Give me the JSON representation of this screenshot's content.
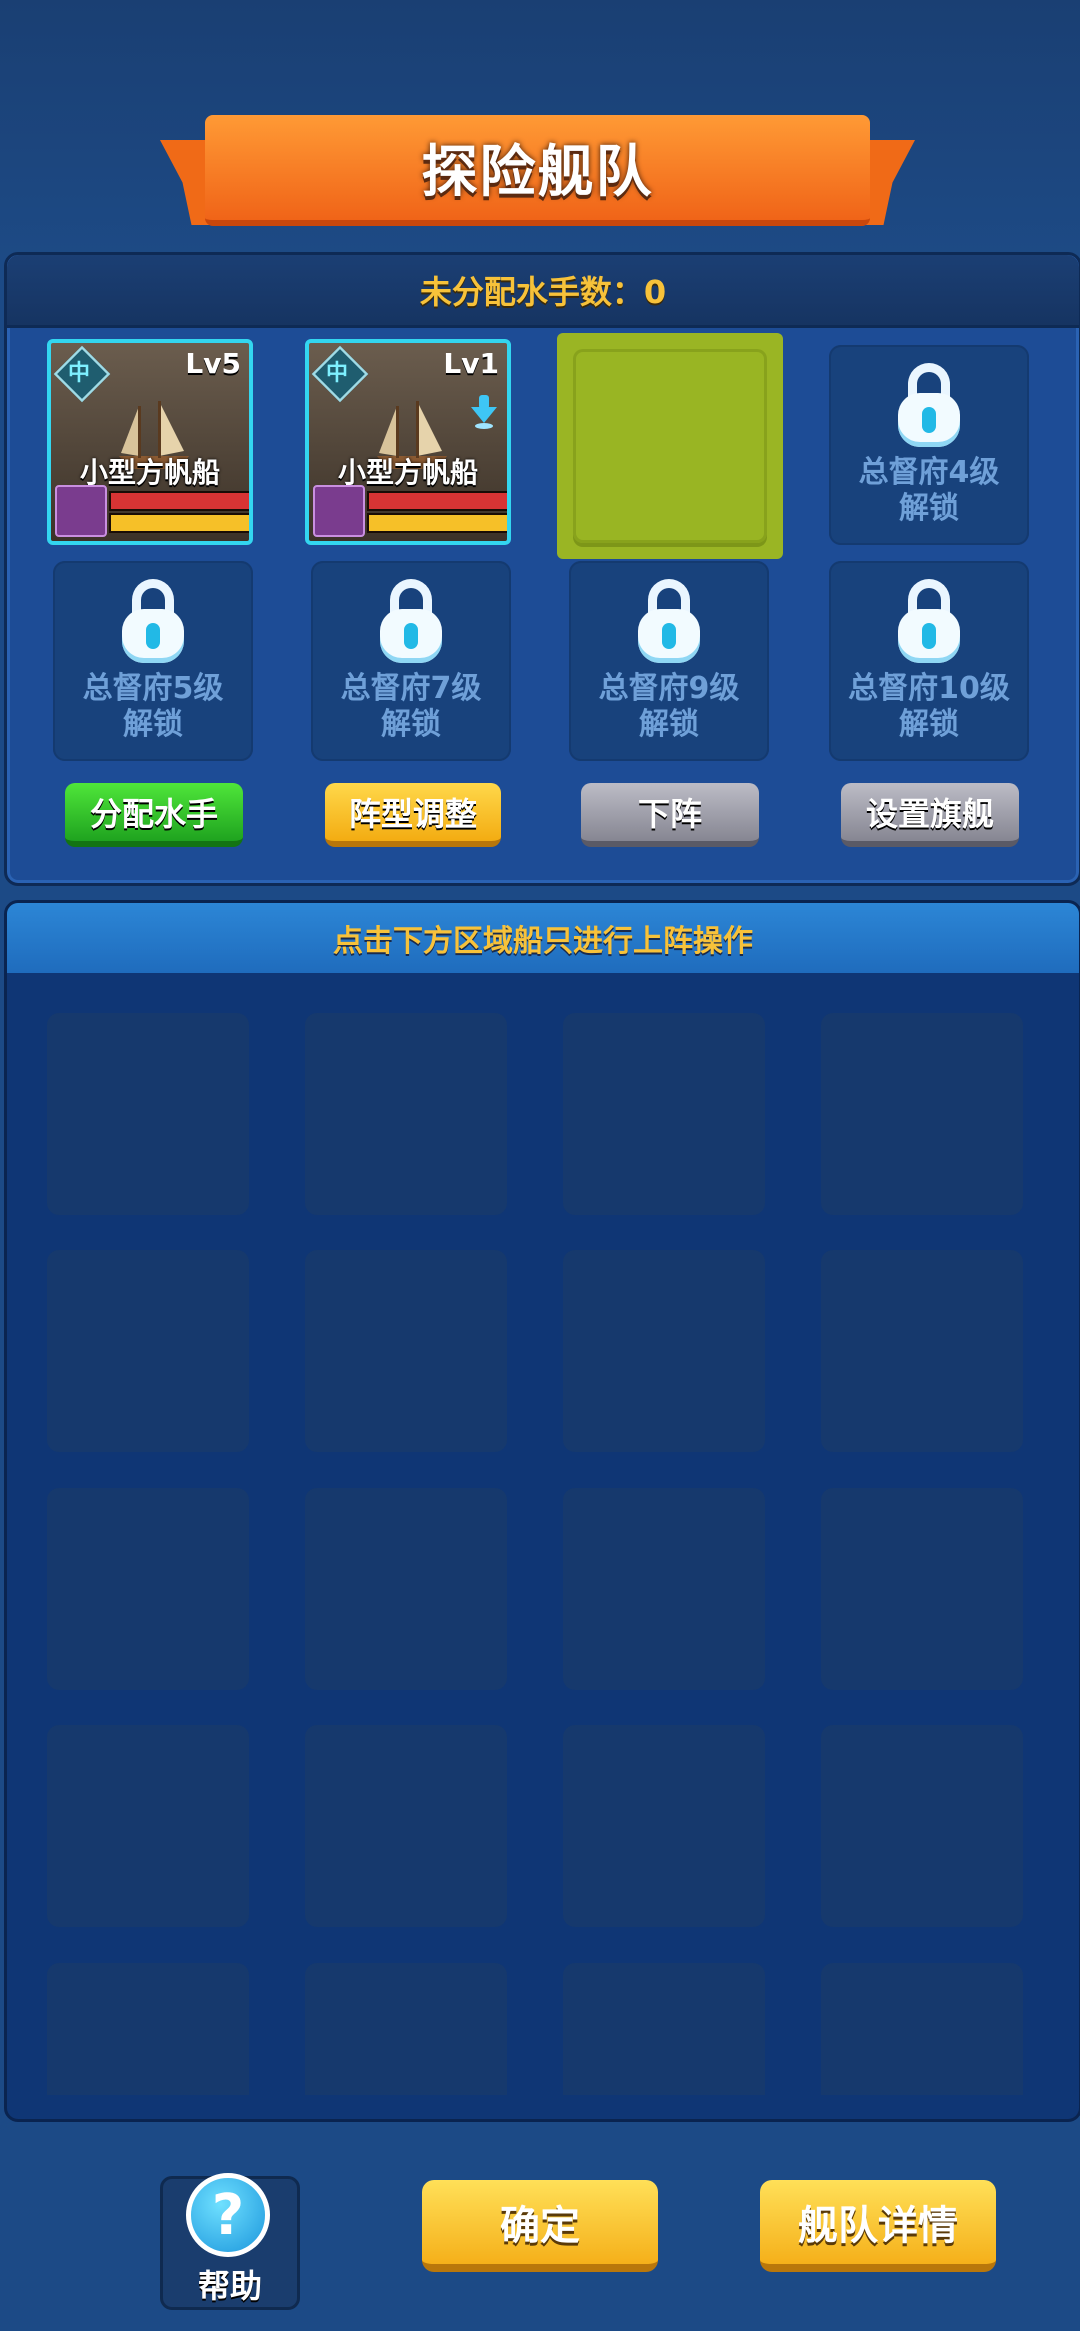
{
  "title": "探险舰队",
  "fleet": {
    "sailor_count_label": "未分配水手数：0",
    "ships": [
      {
        "badge": "中",
        "level": "Lv5",
        "name": "小型方帆船",
        "hp": 1.0,
        "exp": 1.0
      },
      {
        "badge": "中",
        "level": "Lv1",
        "name": "小型方帆船",
        "hp": 1.0,
        "exp": 1.0
      }
    ],
    "locked_slots": [
      {
        "line1": "总督府4级",
        "line2": "解锁"
      },
      {
        "line1": "总督府5级",
        "line2": "解锁"
      },
      {
        "line1": "总督府7级",
        "line2": "解锁"
      },
      {
        "line1": "总督府9级",
        "line2": "解锁"
      },
      {
        "line1": "总督府10级",
        "line2": "解锁"
      }
    ],
    "buttons": {
      "assign": "分配水手",
      "formation": "阵型调整",
      "remove": "下阵",
      "flagship": "设置旗舰"
    }
  },
  "roster": {
    "hint": "点击下方区域船只进行上阵操作"
  },
  "footer": {
    "help": "帮助",
    "confirm": "确定",
    "details": "舰队详情"
  },
  "colors": {
    "background": "#1c4a86",
    "accent_yellow": "#f7c23a",
    "ribbon": "#f06418",
    "slot_highlight": "#9ab524"
  }
}
